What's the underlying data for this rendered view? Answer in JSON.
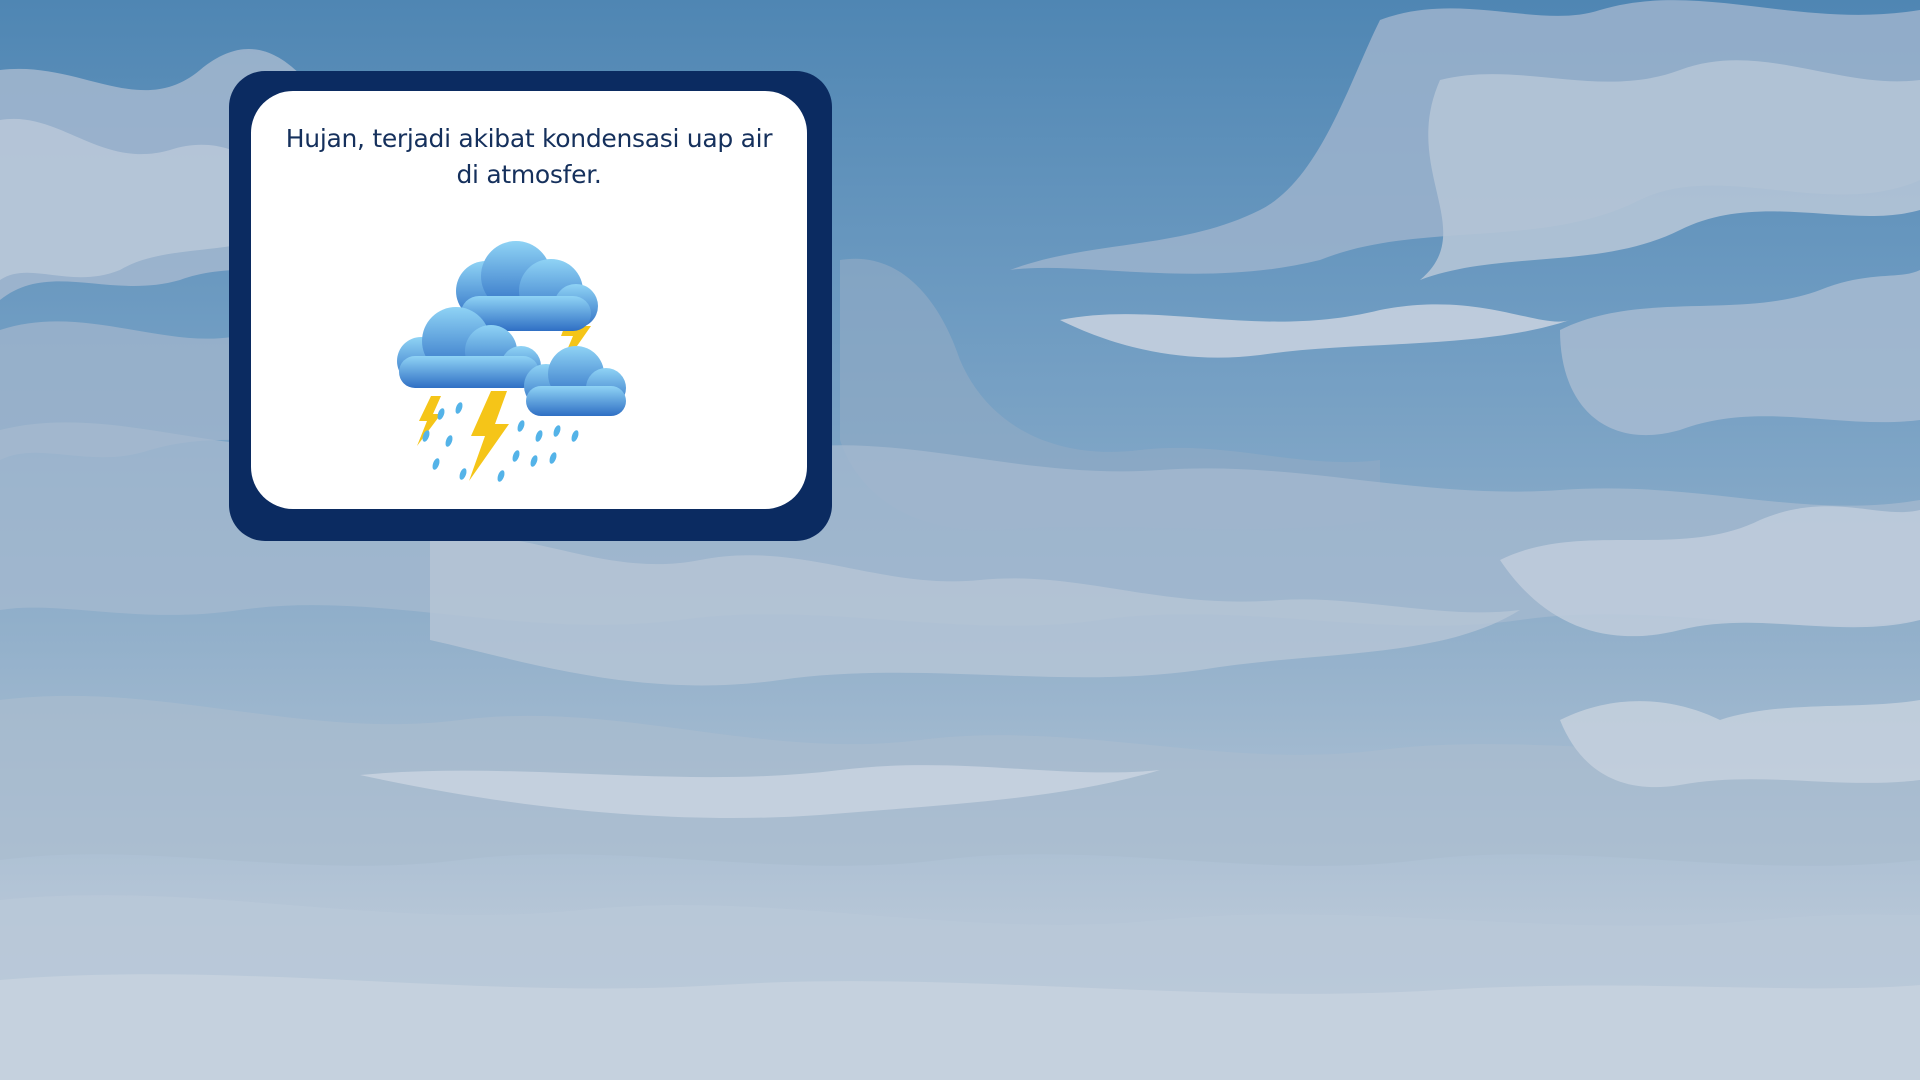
{
  "slide": {
    "caption": "Hujan, terjadi akibat kondensasi uap air di atmosfer.",
    "illustration_icon": "storm-cloud-rain-lightning-icon"
  },
  "colors": {
    "sky_top": "#4f86b3",
    "sky_bottom": "#c3d0de",
    "card_frame": "#0b2b61",
    "card_fill": "#ffffff",
    "caption_text": "#15305c",
    "cloud_blue": "#3f8fd6",
    "lightning": "#f5c518",
    "rain": "#54b3e8"
  }
}
